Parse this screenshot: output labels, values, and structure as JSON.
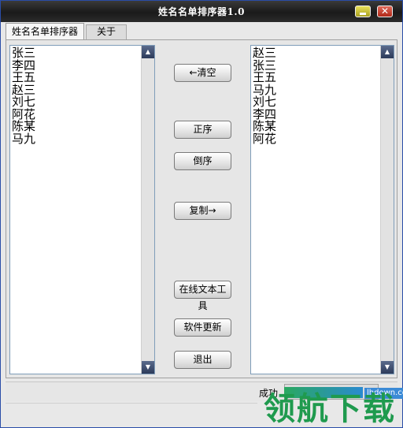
{
  "window": {
    "title": "姓名名单排序器1.0",
    "close_glyph": "✕"
  },
  "tabs": [
    {
      "label": "姓名名单排序器"
    },
    {
      "label": "关于"
    }
  ],
  "left_list": {
    "items": [
      "张三",
      "李四",
      "王五",
      "赵三",
      "刘七",
      "阿花",
      "陈某",
      "马九"
    ]
  },
  "right_list": {
    "items": [
      "赵三",
      "张三",
      "王五",
      "马九",
      "刘七",
      "李四",
      "陈某",
      "阿花"
    ]
  },
  "buttons": {
    "clear": "←清空",
    "ascending": "正序",
    "descending": "倒序",
    "copy": "复制→",
    "online_tools": "在线文本工具",
    "update": "软件更新",
    "exit": "退出"
  },
  "statusbar": {
    "label": "成功"
  },
  "watermark": {
    "site": "lhdown.com",
    "logo": "领航下载"
  }
}
